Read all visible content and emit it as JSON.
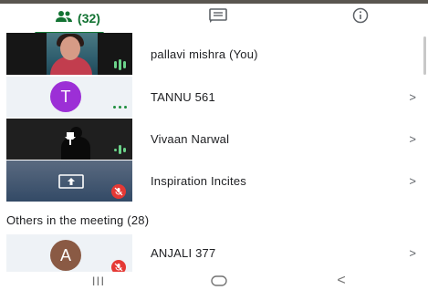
{
  "tabs": {
    "people_label": "(32)",
    "people_icon": "people-icon",
    "chat_icon": "chat-icon",
    "info_icon": "info-icon",
    "active_color": "#137333"
  },
  "participants": [
    {
      "name": "pallavi mishra (You)",
      "tile": "video",
      "indicator": "speaking-wave-icon"
    },
    {
      "name": "TANNU 561",
      "avatar_letter": "T",
      "avatar_color": "#9c2fd6",
      "indicator": "audio-dots-icon",
      "chevron": ">"
    },
    {
      "name": "Vivaan Narwal",
      "tile": "video",
      "indicator": "speaking-wave-icon",
      "pin_icon": "pin-icon",
      "chevron": ">"
    },
    {
      "name": "Inspiration Incites",
      "tile": "presenting",
      "present_icon": "present-screen-icon",
      "indicator": "mic-off-icon",
      "chevron": ">"
    }
  ],
  "others_section": {
    "label": "Others in the meeting (28)",
    "items": [
      {
        "name": "ANJALI 377",
        "avatar_letter": "A",
        "avatar_color": "#8a5a44",
        "indicator": "mic-off-icon",
        "chevron": ">"
      }
    ]
  },
  "navbar": {
    "recents_glyph": "III",
    "back_glyph": "<"
  }
}
